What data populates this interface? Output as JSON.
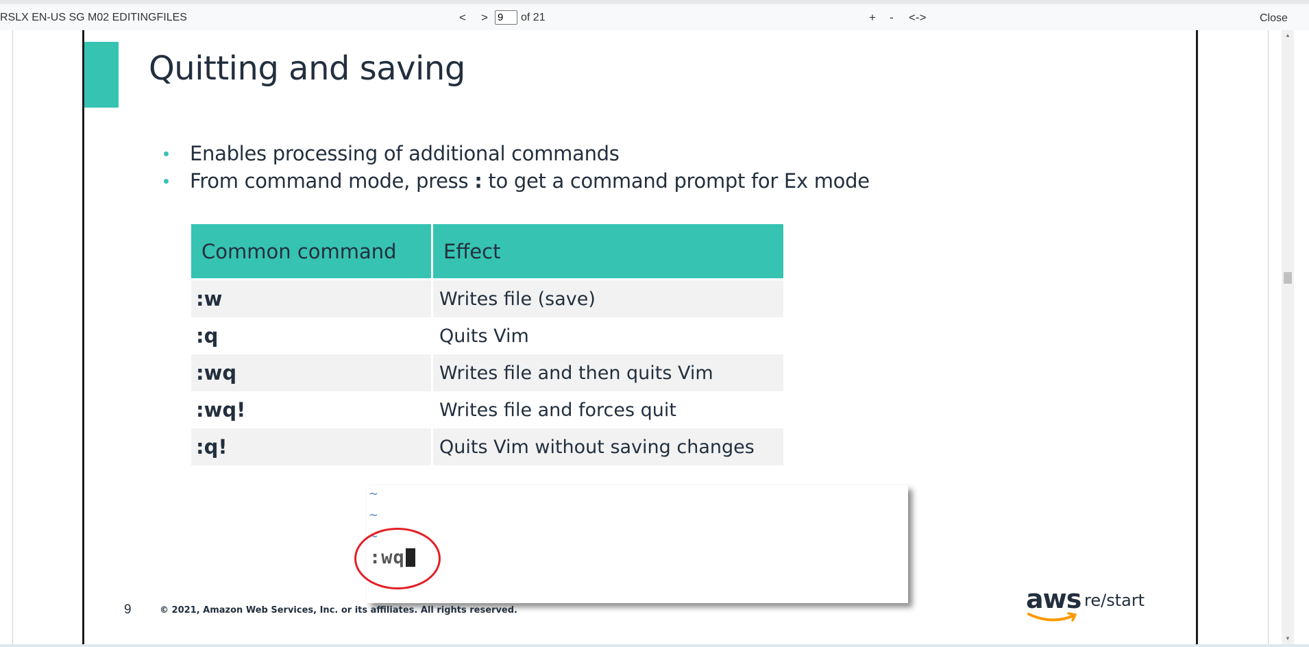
{
  "toolbar": {
    "doc_title": "RSLX EN-US SG M02 EDITINGFILES",
    "prev_label": "<",
    "next_label": ">",
    "page_input_value": "9",
    "page_of": "of 21",
    "zoom_in_label": "+",
    "zoom_out_label": "-",
    "fit_width_label": "<->",
    "close_label": "Close"
  },
  "slide": {
    "title": "Quitting and saving",
    "bullets": {
      "b1": "Enables processing of additional commands",
      "b2_before": "From command mode, press ",
      "b2_key": ":",
      "b2_after": " to get a command prompt for Ex mode"
    },
    "table": {
      "header_cmd": "Common command",
      "header_effect": "Effect",
      "rows": [
        {
          "cmd": ":w",
          "effect": "Writes file (save)"
        },
        {
          "cmd": ":q",
          "effect": "Quits Vim"
        },
        {
          "cmd": ":wq",
          "effect": "Writes file and then quits Vim"
        },
        {
          "cmd": ":wq!",
          "effect": "Writes file and forces quit"
        },
        {
          "cmd": ":q!",
          "effect": "Quits Vim without saving changes"
        }
      ]
    },
    "vim": {
      "tilde": "~",
      "prompt": ":wq"
    },
    "footer": {
      "page_number": "9",
      "copyright": "© 2021, Amazon Web Services, Inc. or its affiliates. All rights reserved.",
      "logo_text": "aws",
      "logo_suffix": "re/start"
    }
  },
  "colors": {
    "accent": "#37c3b2",
    "text": "#232f3e",
    "highlight_circle": "#e31e24",
    "aws_orange": "#ff9900"
  }
}
